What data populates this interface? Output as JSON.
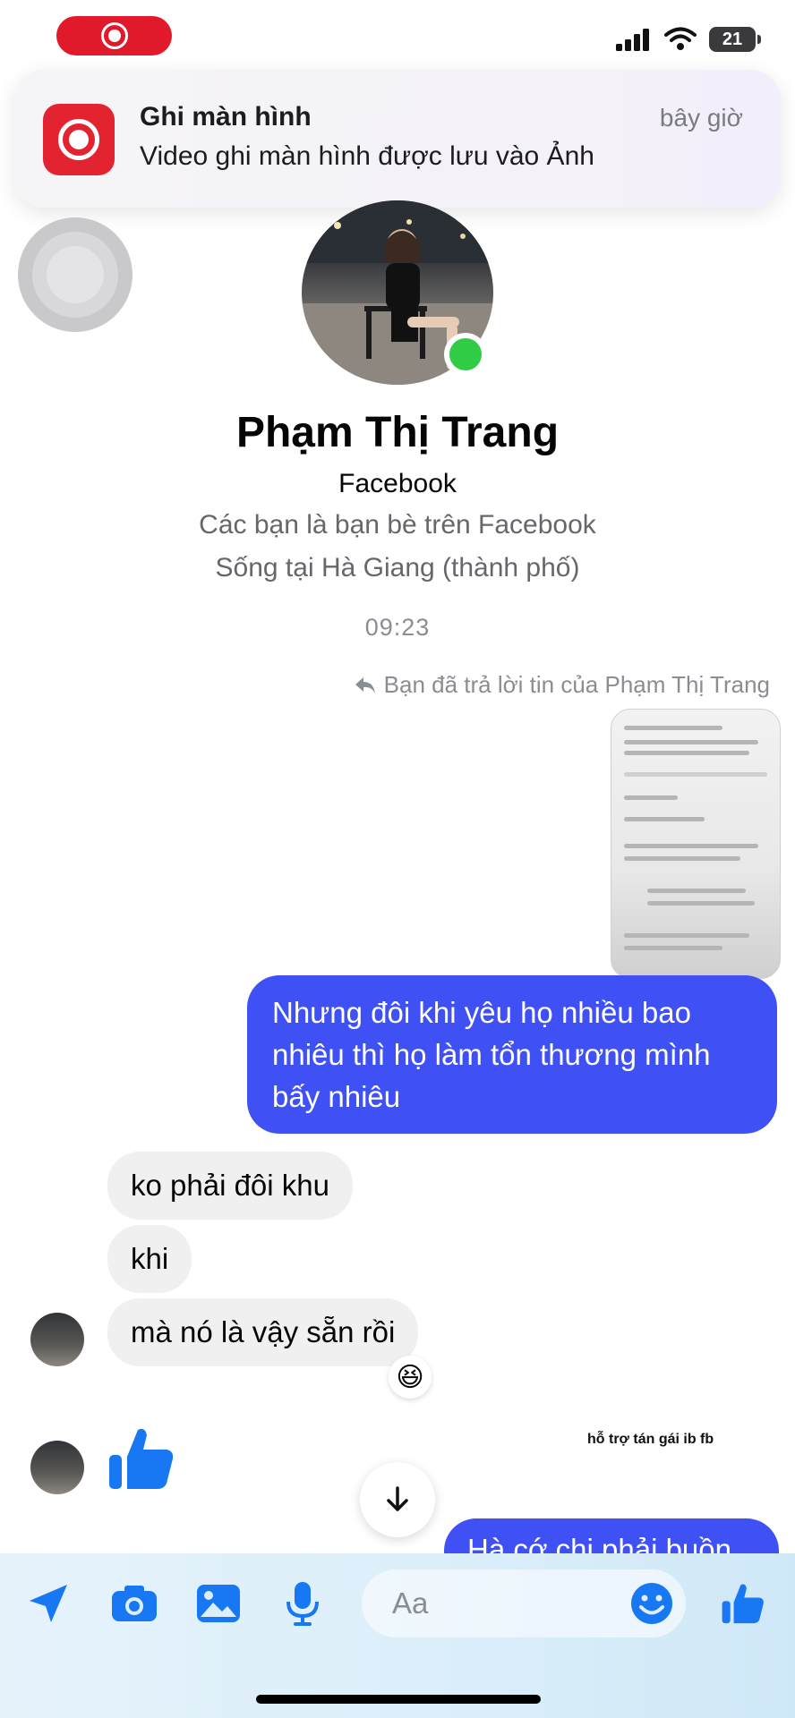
{
  "status_bar": {
    "battery_level": "21",
    "recording_indicator": "screen-record-icon"
  },
  "notification": {
    "title": "Ghi màn hình",
    "time": "bây giờ",
    "body": "Video ghi màn hình được lưu vào Ảnh",
    "icon": "screen-record-icon"
  },
  "profile": {
    "name": "Phạm Thị Trang",
    "source": "Facebook",
    "friends_line": "Các bạn là bạn bè trên Facebook",
    "lives_line": "Sống tại Hà Giang (thành phố)",
    "online": true
  },
  "conversation": {
    "timestamp": "09:23",
    "reply_note": "Bạn đã trả lời tin của Phạm Thị Trang",
    "outgoing_1": "Nhưng đôi khi yêu họ nhiều bao nhiêu thì họ làm tổn thương mình bấy nhiêu",
    "incoming": [
      "ko phải đôi khu",
      "khi",
      "mà nó là vậy sẵn rồi"
    ],
    "reaction": "😆",
    "outgoing_2_partial": "Hà cớ chi phải buồn",
    "watermark": "hỗ trợ tán gái ib fb"
  },
  "composer": {
    "placeholder": "Aa",
    "accent_color": "#1877f2",
    "outgoing_bubble_color": "#3f51f4"
  }
}
